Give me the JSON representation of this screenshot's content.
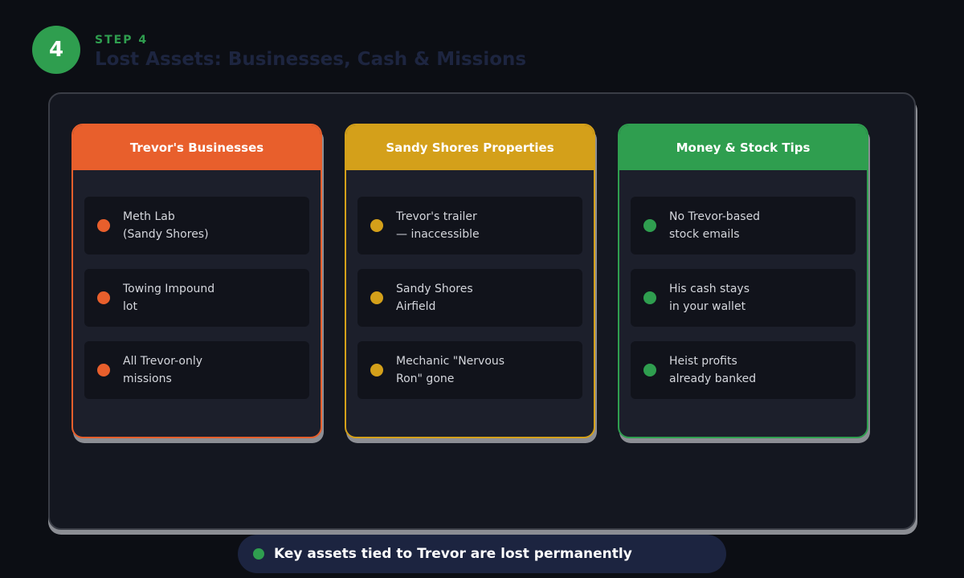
{
  "step": {
    "number": "4",
    "label": "STEP 4",
    "title": "Lost Assets: Businesses, Cash & Missions"
  },
  "cards": [
    {
      "title": "Trevor's Businesses",
      "color": "#e85f2c",
      "items": [
        "Meth Lab\n(Sandy Shores)",
        "Towing Impound\nlot",
        "All Trevor-only\nmissions"
      ]
    },
    {
      "title": "Sandy Shores Properties",
      "color": "#d4a01a",
      "items": [
        "Trevor's trailer\n— inaccessible",
        "Sandy Shores\nAirfield",
        "Mechanic \"Nervous\nRon\" gone"
      ]
    },
    {
      "title": "Money & Stock Tips",
      "color": "#2f9e4f",
      "items": [
        "No Trevor-based\nstock emails",
        "His cash stays\nin your wallet",
        "Heist profits\nalready banked"
      ]
    }
  ],
  "banner": {
    "text": "Key assets tied to Trevor are lost permanently",
    "dot_color": "#2f9e4f"
  }
}
